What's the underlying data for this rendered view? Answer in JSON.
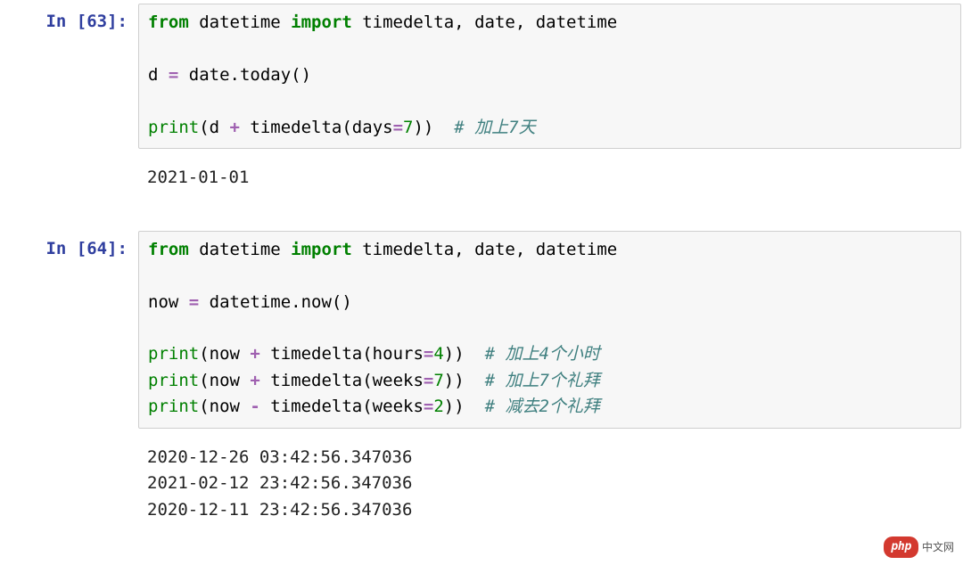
{
  "cells": [
    {
      "prompt": "In [63]:",
      "code": {
        "line1": {
          "kw1": "from",
          "mod": " datetime ",
          "kw2": "import",
          "rest": " timedelta, date, datetime"
        },
        "line2": {
          "lhs": "d ",
          "op": "= ",
          "rhs": "date.today()"
        },
        "line3": {
          "fn": "print",
          "open": "(d ",
          "op": "+ ",
          "call": "timedelta(days",
          "eq": "=",
          "num": "7",
          "close": "))  ",
          "comment": "# 加上7天"
        }
      },
      "output": "2021-01-01"
    },
    {
      "prompt": "In [64]:",
      "code": {
        "line1": {
          "kw1": "from",
          "mod": " datetime ",
          "kw2": "import",
          "rest": " timedelta, date, datetime"
        },
        "line2": {
          "lhs": "now ",
          "op": "= ",
          "rhs": "datetime.now()"
        },
        "line3": {
          "fn": "print",
          "open": "(now ",
          "op": "+ ",
          "call": "timedelta(hours",
          "eq": "=",
          "num": "4",
          "close": "))  ",
          "comment": "# 加上4个小时"
        },
        "line4": {
          "fn": "print",
          "open": "(now ",
          "op": "+ ",
          "call": "timedelta(weeks",
          "eq": "=",
          "num": "7",
          "close": "))  ",
          "comment": "# 加上7个礼拜"
        },
        "line5": {
          "fn": "print",
          "open": "(now ",
          "op": "- ",
          "call": "timedelta(weeks",
          "eq": "=",
          "num": "2",
          "close": "))  ",
          "comment": "# 减去2个礼拜"
        }
      },
      "output": "2020-12-26 03:42:56.347036\n2021-02-12 23:42:56.347036\n2020-12-11 23:42:56.347036"
    }
  ],
  "watermark": {
    "pill": "php",
    "text": "中文网"
  }
}
